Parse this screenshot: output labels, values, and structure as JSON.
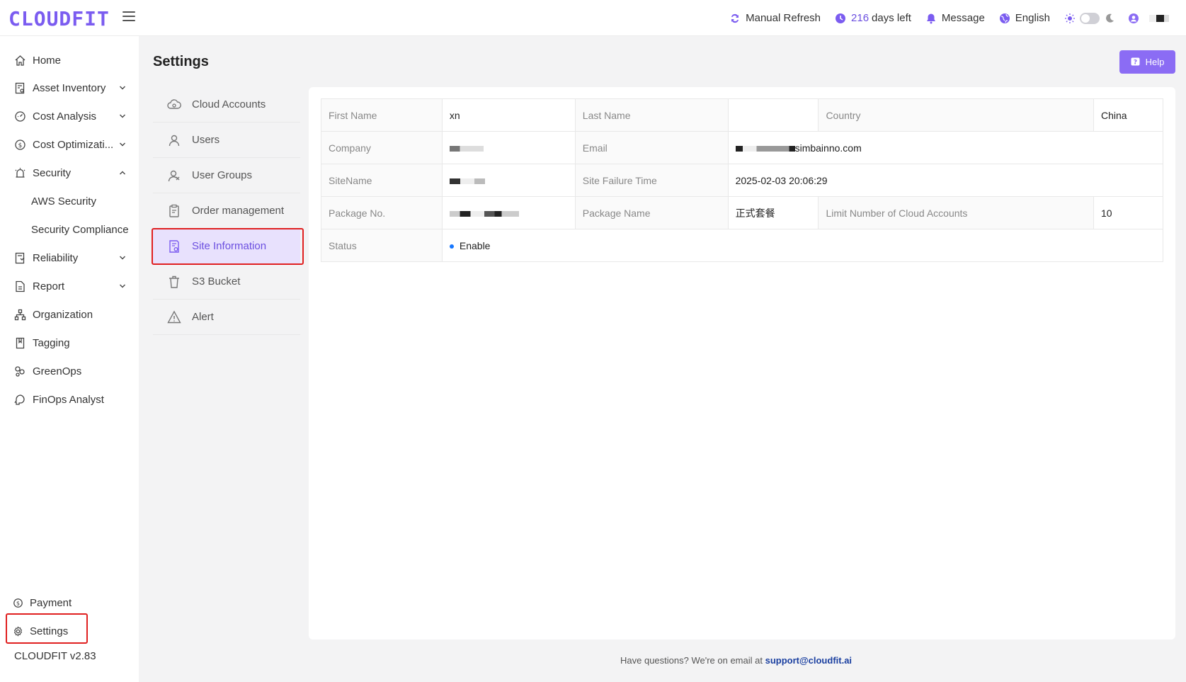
{
  "app": {
    "logo": "CLOUDFIT",
    "version": "CLOUDFIT v2.83"
  },
  "topbar": {
    "refresh_label": "Manual Refresh",
    "days_number": "216",
    "days_label": "days left",
    "message_label": "Message",
    "language_label": "English",
    "accent_color": "#6b4fe0"
  },
  "sidebar": {
    "items": [
      {
        "label": "Home",
        "icon": "home-icon"
      },
      {
        "label": "Asset Inventory",
        "icon": "inventory-icon",
        "expandable": true
      },
      {
        "label": "Cost Analysis",
        "icon": "cost-analysis-icon",
        "expandable": true
      },
      {
        "label": "Cost Optimizati...",
        "icon": "dollar-circle-icon",
        "expandable": true
      },
      {
        "label": "Security",
        "icon": "alarm-icon",
        "expanded": true
      },
      {
        "label": "AWS Security",
        "sub": true
      },
      {
        "label": "Security Compliance",
        "sub": true
      },
      {
        "label": "Reliability",
        "icon": "reliability-icon",
        "expandable": true
      },
      {
        "label": "Report",
        "icon": "report-icon",
        "expandable": true
      },
      {
        "label": "Organization",
        "icon": "org-icon"
      },
      {
        "label": "Tagging",
        "icon": "bookmark-icon"
      },
      {
        "label": "GreenOps",
        "icon": "leaf-icon"
      },
      {
        "label": "FinOps Analyst",
        "icon": "brain-icon"
      }
    ],
    "payment_label": "Payment",
    "settings_label": "Settings"
  },
  "page": {
    "title": "Settings",
    "help_label": "Help"
  },
  "subnav": {
    "items": [
      {
        "label": "Cloud Accounts",
        "icon": "cloud-icon"
      },
      {
        "label": "Users",
        "icon": "user-icon"
      },
      {
        "label": "User Groups",
        "icon": "user-group-icon"
      },
      {
        "label": "Order management",
        "icon": "clipboard-icon"
      },
      {
        "label": "Site Information",
        "icon": "document-icon",
        "active": true
      },
      {
        "label": "S3 Bucket",
        "icon": "bucket-icon"
      },
      {
        "label": "Alert",
        "icon": "warning-icon"
      }
    ]
  },
  "site_info": {
    "first_name_label": "First Name",
    "first_name": "xn",
    "last_name_label": "Last Name",
    "last_name": "",
    "country_label": "Country",
    "country": "China",
    "company_label": "Company",
    "email_label": "Email",
    "email_visible": "simbainno.com",
    "sitename_label": "SiteName",
    "site_failure_label": "Site Failure Time",
    "site_failure_time": "2025-02-03 20:06:29",
    "package_no_label": "Package No.",
    "package_name_label": "Package Name",
    "package_name": "正式套餐",
    "limit_label": "Limit Number of Cloud Accounts",
    "limit_value": "10",
    "status_label": "Status",
    "status_value": "Enable"
  },
  "footer": {
    "text": "Have questions? We're on email at",
    "email": "support@cloudfit.ai"
  }
}
